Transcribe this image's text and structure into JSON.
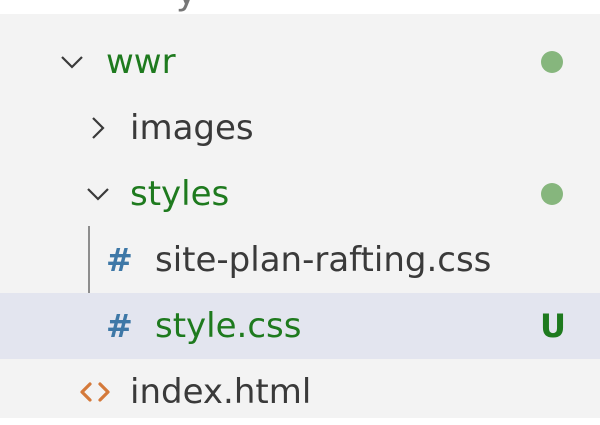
{
  "tree": {
    "items": [
      {
        "label": "wwr",
        "kind": "folder",
        "expanded": true,
        "status": "dot"
      },
      {
        "label": "images",
        "kind": "folder",
        "expanded": false
      },
      {
        "label": "styles",
        "kind": "folder",
        "expanded": true,
        "status": "dot"
      },
      {
        "label": "site-plan-rafting.css",
        "kind": "css-file"
      },
      {
        "label": "style.css",
        "kind": "css-file",
        "selected": true,
        "status_label": "U"
      },
      {
        "label": "index.html",
        "kind": "html-file"
      }
    ],
    "icons": {
      "expanded": "chevron-down-icon",
      "collapsed": "chevron-right-icon",
      "css": "hash-icon",
      "html": "angle-brackets-icon"
    },
    "colors": {
      "modified_text": "#1e7a1e",
      "status_dot": "#86b67d",
      "css_icon": "#3e78a7",
      "html_icon": "#d4793a",
      "selected_row": "#e3e5ef"
    },
    "hash_glyph": "#"
  }
}
